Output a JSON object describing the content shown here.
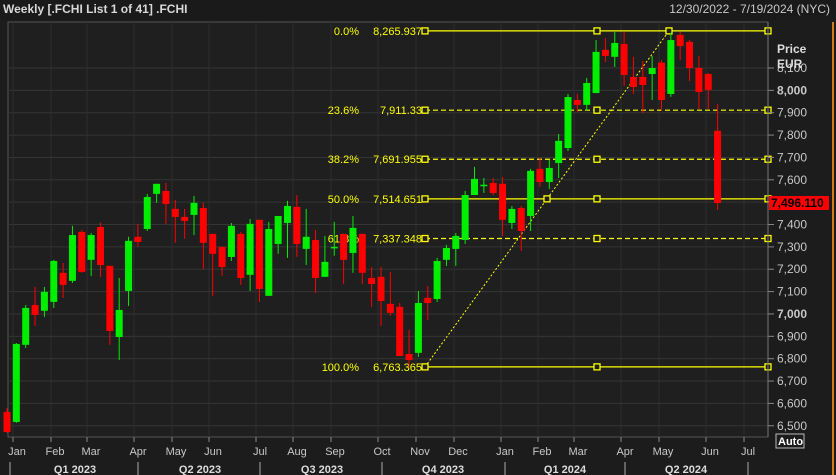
{
  "header": {
    "title": "Weekly [.FCHI List 1 of 41] .FCHI",
    "date_range": "12/30/2022 - 7/19/2024 (NYC)"
  },
  "axis": {
    "price_label": "Price",
    "currency_label": "EUR",
    "auto_button": "Auto",
    "current_price_label": "7,496.110"
  },
  "colors": {
    "up": "#00ee00",
    "down": "#ff0000",
    "fib": "#ffff00",
    "background": "#1f1f1f",
    "grid": "#353535"
  },
  "chart_data": {
    "type": "candlestick",
    "title": "Weekly .FCHI",
    "ylabel": "Price EUR",
    "ylim": [
      6450,
      8300
    ],
    "y_ticks": [
      "6,500",
      "6,600",
      "6,700",
      "6,800",
      "6,900",
      "7,000",
      "7,100",
      "7,200",
      "7,300",
      "7,400",
      "7,500",
      "7,600",
      "7,700",
      "7,800",
      "7,900",
      "8,000",
      "8,100"
    ],
    "y_tick_values": [
      6500,
      6600,
      6700,
      6800,
      6900,
      7000,
      7100,
      7200,
      7300,
      7400,
      7500,
      7600,
      7700,
      7800,
      7900,
      8000,
      8100
    ],
    "current_price": 7496.11,
    "x_month_labels": [
      "Jan",
      "Feb",
      "Mar",
      "Apr",
      "May",
      "Jun",
      "Jul",
      "Aug",
      "Sep",
      "Oct",
      "Nov",
      "Dec",
      "Jan",
      "Feb",
      "Mar",
      "Apr",
      "May",
      "Jun",
      "Jul"
    ],
    "x_quarter_labels": [
      "Q1 2023",
      "Q2 2023",
      "Q3 2023",
      "Q4 2023",
      "Q1 2024",
      "Q2 2024"
    ],
    "ohlc": [
      [
        6562,
        6580,
        6468,
        6472
      ],
      [
        6517,
        6870,
        6513,
        6866
      ],
      [
        6862,
        7040,
        6848,
        7027
      ],
      [
        7040,
        7121,
        6947,
        6996
      ],
      [
        7014,
        7121,
        6987,
        7099
      ],
      [
        7054,
        7242,
        7027,
        7237
      ],
      [
        7184,
        7228,
        7072,
        7130
      ],
      [
        7148,
        7394,
        7139,
        7353
      ],
      [
        7367,
        7376,
        7184,
        7188
      ],
      [
        7242,
        7362,
        7170,
        7353
      ],
      [
        7389,
        7407,
        7166,
        7219
      ],
      [
        7215,
        7215,
        6862,
        6924
      ],
      [
        6897,
        7161,
        6794,
        7018
      ],
      [
        7103,
        7345,
        7036,
        7327
      ],
      [
        7345,
        7403,
        7300,
        7322
      ],
      [
        7380,
        7537,
        7371,
        7523
      ],
      [
        7537,
        7582,
        7497,
        7582
      ],
      [
        7550,
        7586,
        7403,
        7492
      ],
      [
        7470,
        7510,
        7318,
        7434
      ],
      [
        7434,
        7470,
        7336,
        7416
      ],
      [
        7443,
        7528,
        7353,
        7497
      ],
      [
        7474,
        7497,
        7201,
        7318
      ],
      [
        7358,
        7358,
        7081,
        7269
      ],
      [
        7300,
        7300,
        7170,
        7210
      ],
      [
        7255,
        7407,
        7237,
        7394
      ],
      [
        7358,
        7367,
        7130,
        7161
      ],
      [
        7175,
        7425,
        7103,
        7403
      ],
      [
        7421,
        7421,
        7054,
        7112
      ],
      [
        7081,
        7412,
        7081,
        7380
      ],
      [
        7313,
        7438,
        7269,
        7438
      ],
      [
        7407,
        7506,
        7251,
        7483
      ],
      [
        7479,
        7532,
        7255,
        7313
      ],
      [
        7291,
        7470,
        7219,
        7345
      ],
      [
        7331,
        7376,
        7094,
        7161
      ],
      [
        7166,
        7349,
        7166,
        7233
      ],
      [
        7295,
        7412,
        7260,
        7300
      ],
      [
        7358,
        7358,
        7134,
        7242
      ],
      [
        7273,
        7438,
        7184,
        7385
      ],
      [
        7358,
        7358,
        7134,
        7184
      ],
      [
        7161,
        7210,
        7032,
        7134
      ],
      [
        7166,
        7210,
        6947,
        7058
      ],
      [
        7045,
        7188,
        6992,
        7005
      ],
      [
        7032,
        7049,
        6812,
        6812
      ],
      [
        6821,
        6929,
        6763,
        6794
      ],
      [
        6826,
        7103,
        6808,
        7049
      ],
      [
        7072,
        7125,
        6973,
        7049
      ],
      [
        7067,
        7251,
        7054,
        7237
      ],
      [
        7242,
        7309,
        7215,
        7295
      ],
      [
        7291,
        7362,
        7215,
        7349
      ],
      [
        7331,
        7550,
        7313,
        7532
      ],
      [
        7532,
        7658,
        7532,
        7604
      ],
      [
        7573,
        7608,
        7541,
        7578
      ],
      [
        7586,
        7608,
        7532,
        7541
      ],
      [
        7582,
        7613,
        7349,
        7421
      ],
      [
        7407,
        7483,
        7380,
        7470
      ],
      [
        7474,
        7483,
        7282,
        7371
      ],
      [
        7438,
        7649,
        7371,
        7640
      ],
      [
        7649,
        7698,
        7568,
        7590
      ],
      [
        7590,
        7689,
        7559,
        7653
      ],
      [
        7675,
        7805,
        7608,
        7774
      ],
      [
        7742,
        7984,
        7729,
        7970
      ],
      [
        7957,
        7984,
        7904,
        7935
      ],
      [
        7935,
        8056,
        7908,
        8033
      ],
      [
        7988,
        8225,
        7988,
        8172
      ],
      [
        8181,
        8234,
        8127,
        8154
      ],
      [
        8150,
        8261,
        8105,
        8212
      ],
      [
        8207,
        8261,
        8020,
        8069
      ],
      [
        8060,
        8150,
        7984,
        8015
      ],
      [
        8060,
        8131,
        7899,
        8024
      ],
      [
        8073,
        8154,
        7957,
        8100
      ],
      [
        8124,
        8136,
        7908,
        7957
      ],
      [
        7984,
        8257,
        7971,
        8225
      ],
      [
        8248,
        8261,
        8136,
        8198
      ],
      [
        8217,
        8225,
        8042,
        8100
      ],
      [
        8100,
        8154,
        7917,
        7993
      ],
      [
        8073,
        8078,
        7917,
        8002
      ],
      [
        7819,
        7939,
        7465,
        7496.11
      ]
    ],
    "fibonacci": {
      "high": 8265.937,
      "low": 6763.365,
      "levels": [
        {
          "pct": "0.0%",
          "label": "8,265.937",
          "price": 8265.937,
          "dashed": false
        },
        {
          "pct": "23.6%",
          "label": "7,911.33",
          "price": 7911.33,
          "dashed": true
        },
        {
          "pct": "38.2%",
          "label": "7,691.955",
          "price": 7691.955,
          "dashed": true
        },
        {
          "pct": "50.0%",
          "label": "7,514.651",
          "price": 7514.651,
          "dashed": false
        },
        {
          "pct": "61.8%",
          "label": "7,337.348",
          "price": 7337.348,
          "dashed": true
        },
        {
          "pct": "100.0%",
          "label": "6,763.365",
          "price": 6763.365,
          "dashed": false
        }
      ]
    }
  }
}
